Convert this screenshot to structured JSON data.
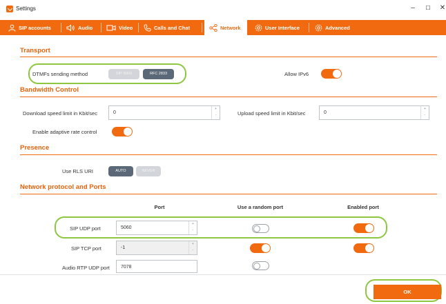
{
  "window": {
    "title": "Settings",
    "minimize": "–",
    "maximize": "☐",
    "close": "✕"
  },
  "tabs": [
    {
      "label": "SIP accounts",
      "icon": "user-icon"
    },
    {
      "label": "Audio",
      "icon": "speaker-icon"
    },
    {
      "label": "Video",
      "icon": "video-icon"
    },
    {
      "label": "Calls and Chat",
      "icon": "phone-icon"
    },
    {
      "label": "Network",
      "icon": "share-icon",
      "active": true
    },
    {
      "label": "User Interface",
      "icon": "gear-icon"
    },
    {
      "label": "Advanced",
      "icon": "gear-icon"
    }
  ],
  "transport": {
    "title": "Transport",
    "dtmf_label": "DTMFs sending method",
    "dtmf_options": [
      "SIP INFO",
      "RFC 2833"
    ],
    "dtmf_selected": "RFC 2833",
    "ipv6_label": "Allow IPv6",
    "ipv6_enabled": true
  },
  "bandwidth": {
    "title": "Bandwidth Control",
    "download_label": "Download speed limit in Kbit/sec",
    "download_value": "0",
    "upload_label": "Upload speed limit in Kbit/sec",
    "upload_value": "0",
    "adaptive_label": "Enable adaptive rate control",
    "adaptive_enabled": true
  },
  "presence": {
    "title": "Presence",
    "rls_label": "Use RLS URI",
    "rls_options": [
      "AUTO",
      "NEVER"
    ],
    "rls_selected": "AUTO"
  },
  "ports": {
    "title": "Network protocol and Ports",
    "headers": [
      "Port",
      "Use a random port",
      "Enabled port"
    ],
    "rows": [
      {
        "label": "SIP UDP port",
        "port": "5060",
        "random": false,
        "enabled": true
      },
      {
        "label": "SIP TCP port",
        "port": "-1",
        "random": true,
        "enabled": true
      },
      {
        "label": "Audio RTP UDP port",
        "port": "7078",
        "random": false,
        "enabled": null
      }
    ]
  },
  "footer": {
    "ok_label": "OK"
  },
  "colors": {
    "accent": "#f26a10",
    "highlight": "#8dc63f",
    "pill_on": "#5b6877",
    "pill_off": "#d2d5d9"
  }
}
